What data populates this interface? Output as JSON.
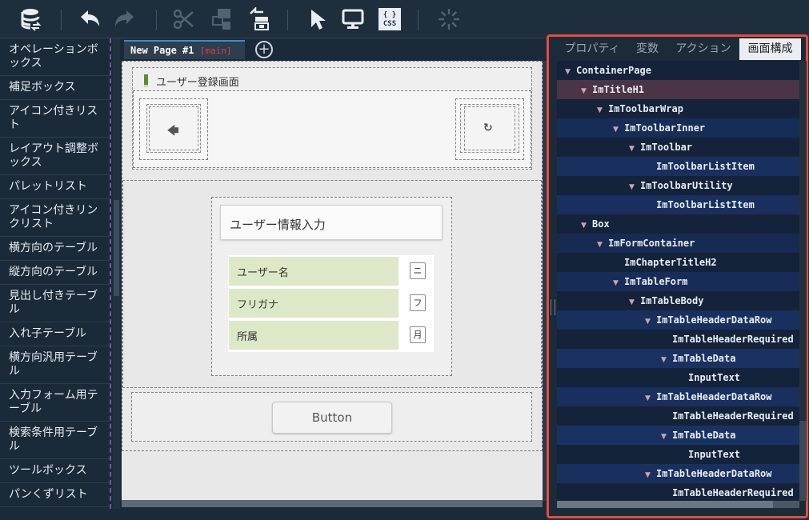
{
  "toolbar": {
    "buttons": [
      "database-sync-icon",
      "undo-icon",
      "redo-icon",
      "cut-icon",
      "copy-component-icon",
      "paste-component-icon",
      "select-pointer-icon",
      "preview-monitor-icon",
      "css-icon",
      "loading-spinner-icon"
    ],
    "css_label": "CSS",
    "css_braces": "{ }"
  },
  "palette": {
    "items": [
      "オペレーションボックス",
      "補足ボックス",
      "アイコン付きリスト",
      "レイアウト調整ボックス",
      "パレットリスト",
      "アイコン付きリンクリスト",
      "横方向のテーブル",
      "縦方向のテーブル",
      "見出し付きテーブル",
      "入れ子テーブル",
      "横方向汎用テーブル",
      "入力フォーム用テーブル",
      "検索条件用テーブル",
      "ツールボックス",
      "パンくずリスト"
    ]
  },
  "page_tab": {
    "label": "New Page #1",
    "branch": "[main]",
    "add_label": "+"
  },
  "canvas": {
    "page_title": "ユーザー登録画面",
    "back_icon": "🡄",
    "refresh_icon": "↻",
    "chapter_title": "ユーザー情報入力",
    "rows": [
      {
        "header": "ユーザー名",
        "input_hint": "ニ"
      },
      {
        "header": "フリガナ",
        "input_hint": "フ"
      },
      {
        "header": "所属",
        "input_hint": "月"
      }
    ],
    "button_label": "Button"
  },
  "right_panel": {
    "tabs": [
      "プロパティ",
      "変数",
      "アクション",
      "画面構成"
    ],
    "active_tab": "画面構成",
    "tree": [
      {
        "label": "ContainerPage",
        "level": 0,
        "toggle": true,
        "selected": false
      },
      {
        "label": "ImTitleH1",
        "level": 1,
        "toggle": true,
        "selected": true
      },
      {
        "label": "ImToolbarWrap",
        "level": 2,
        "toggle": true,
        "selected": false
      },
      {
        "label": "ImToolbarInner",
        "level": 3,
        "toggle": true,
        "selected": false
      },
      {
        "label": "ImToolbar",
        "level": 4,
        "toggle": true,
        "selected": false
      },
      {
        "label": "ImToolbarListItem",
        "level": 5,
        "toggle": false,
        "selected": false
      },
      {
        "label": "ImToolbarUtility",
        "level": 4,
        "toggle": true,
        "selected": false
      },
      {
        "label": "ImToolbarListItem",
        "level": 5,
        "toggle": false,
        "selected": false
      },
      {
        "label": "Box",
        "level": 1,
        "toggle": true,
        "selected": false
      },
      {
        "label": "ImFormContainer",
        "level": 2,
        "toggle": true,
        "selected": false
      },
      {
        "label": "ImChapterTitleH2",
        "level": 3,
        "toggle": false,
        "selected": false
      },
      {
        "label": "ImTableForm",
        "level": 3,
        "toggle": true,
        "selected": false
      },
      {
        "label": "ImTableBody",
        "level": 4,
        "toggle": true,
        "selected": false
      },
      {
        "label": "ImTableHeaderDataRow",
        "level": 5,
        "toggle": true,
        "selected": false
      },
      {
        "label": "ImTableHeaderRequired",
        "level": 6,
        "toggle": false,
        "selected": false
      },
      {
        "label": "ImTableData",
        "level": 6,
        "toggle": true,
        "selected": false
      },
      {
        "label": "InputText",
        "level": 7,
        "toggle": false,
        "selected": false
      },
      {
        "label": "ImTableHeaderDataRow",
        "level": 5,
        "toggle": true,
        "selected": false
      },
      {
        "label": "ImTableHeaderRequired",
        "level": 6,
        "toggle": false,
        "selected": false
      },
      {
        "label": "ImTableData",
        "level": 6,
        "toggle": true,
        "selected": false
      },
      {
        "label": "InputText",
        "level": 7,
        "toggle": false,
        "selected": false
      },
      {
        "label": "ImTableHeaderDataRow",
        "level": 5,
        "toggle": true,
        "selected": false
      },
      {
        "label": "ImTableHeaderRequired",
        "level": 6,
        "toggle": false,
        "selected": false
      }
    ]
  },
  "colors": {
    "highlight_border": "#e74c3c",
    "selected_node": "#4a3446",
    "table_header": "#dde8c7",
    "accent_tab": "#3d8bd0"
  }
}
